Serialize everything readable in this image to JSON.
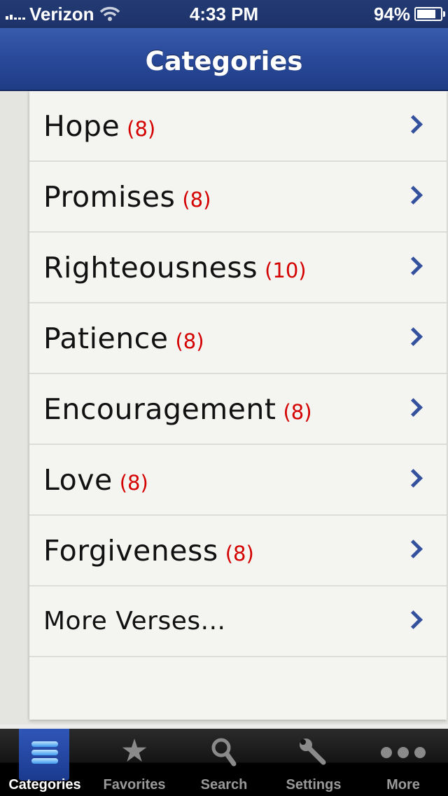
{
  "status_bar": {
    "carrier": "Verizon",
    "time": "4:33 PM",
    "battery_percent": "94%",
    "battery_level": 0.94,
    "signal_icon": "signal-bars-icon",
    "wifi_icon": "wifi-icon"
  },
  "nav": {
    "title": "Categories"
  },
  "categories": [
    {
      "label": "Hope",
      "count": "(8)"
    },
    {
      "label": "Promises",
      "count": "(8)"
    },
    {
      "label": "Righteousness",
      "count": "(10)"
    },
    {
      "label": "Patience",
      "count": "(8)"
    },
    {
      "label": "Encouragement",
      "count": "(8)"
    },
    {
      "label": "Love",
      "count": "(8)"
    },
    {
      "label": "Forgiveness",
      "count": "(8)"
    }
  ],
  "more_row": {
    "label": "More Verses..."
  },
  "tabs": [
    {
      "label": "Categories",
      "icon": "list-icon",
      "active": true
    },
    {
      "label": "Favorites",
      "icon": "star-icon",
      "active": false
    },
    {
      "label": "Search",
      "icon": "search-icon",
      "active": false
    },
    {
      "label": "Settings",
      "icon": "wrench-icon",
      "active": false
    },
    {
      "label": "More",
      "icon": "more-dots-icon",
      "active": false
    }
  ],
  "colors": {
    "nav_blue": "#2a4a9a",
    "count_red": "#d40000",
    "chevron_blue": "#34519e"
  }
}
